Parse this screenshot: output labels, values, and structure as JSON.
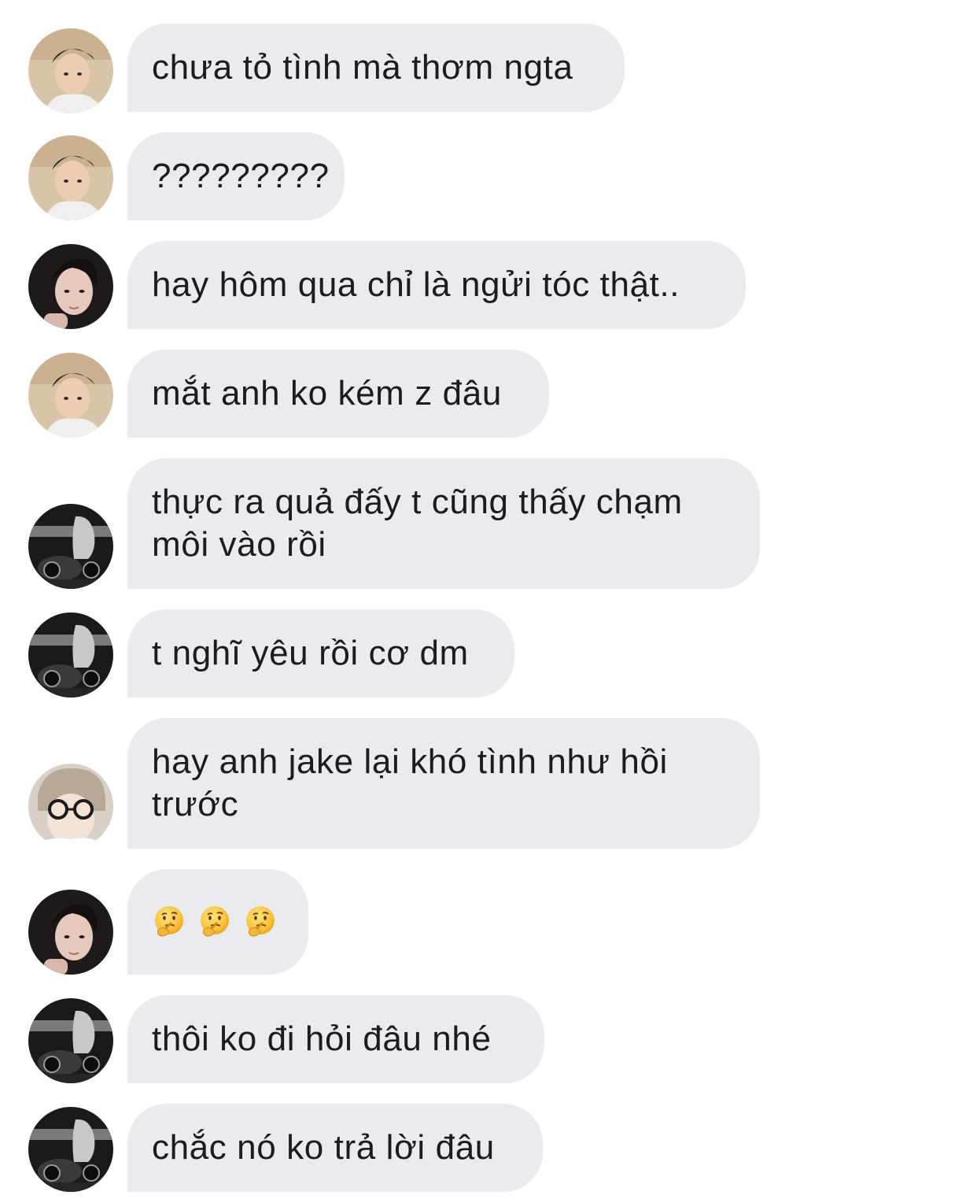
{
  "messages": [
    {
      "avatar": "avatar-a",
      "text": "chưa tỏ tình mà thơm ngta"
    },
    {
      "avatar": "avatar-a",
      "text": "?????????"
    },
    {
      "avatar": "avatar-b",
      "text": "hay hôm qua chỉ là ngửi tóc thật.."
    },
    {
      "avatar": "avatar-a",
      "text": "mắt anh ko kém z đâu"
    },
    {
      "avatar": "avatar-c",
      "text": "thực ra quả đấy t cũng thấy chạm\nmôi vào rồi"
    },
    {
      "avatar": "avatar-c",
      "text": "t nghĩ yêu rồi cơ dm"
    },
    {
      "avatar": "avatar-d",
      "text": "hay anh jake lại khó tình như hồi\ntrước"
    },
    {
      "avatar": "avatar-b",
      "emoji": [
        "thinking-face-icon",
        "thinking-face-icon",
        "thinking-face-icon"
      ]
    },
    {
      "avatar": "avatar-c",
      "text": "thôi ko đi hỏi đâu nhé"
    },
    {
      "avatar": "avatar-c",
      "text": "chắc nó ko trả lời đâu"
    }
  ],
  "colors": {
    "bubble": "#e9ebef",
    "text": "#1c1c1e",
    "background": "#ffffff"
  }
}
